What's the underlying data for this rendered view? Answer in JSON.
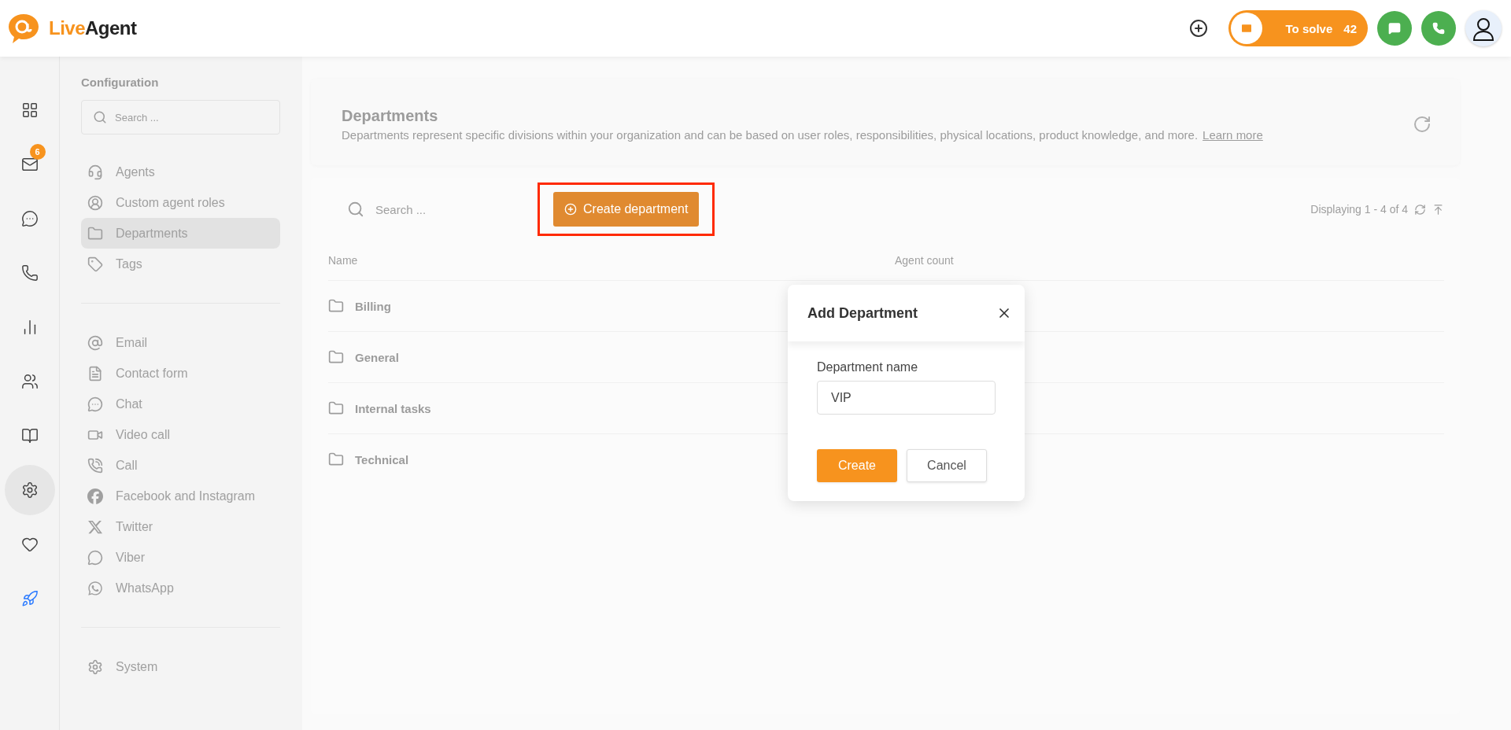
{
  "topbar": {
    "logo": {
      "part1": "Live",
      "part2": "Agent"
    },
    "to_solve": {
      "label": "To solve",
      "count": "42"
    }
  },
  "rail": [
    {
      "selected": false
    },
    {
      "selected": false,
      "badge": "6"
    },
    {
      "selected": false
    },
    {
      "selected": false
    },
    {
      "selected": false
    },
    {
      "selected": false
    },
    {
      "selected": false
    },
    {
      "selected": true
    },
    {
      "selected": false
    },
    {
      "selected": false
    }
  ],
  "config": {
    "title": "Configuration",
    "search": {
      "placeholder": "Search ..."
    },
    "groups": [
      {
        "items": [
          {
            "label": "Agents",
            "selected": false
          },
          {
            "label": "Custom agent roles",
            "selected": false
          },
          {
            "label": "Departments",
            "selected": true
          },
          {
            "label": "Tags",
            "selected": false
          }
        ]
      },
      {
        "items": [
          {
            "label": "Email",
            "selected": false
          },
          {
            "label": "Contact form",
            "selected": false
          },
          {
            "label": "Chat",
            "selected": false
          },
          {
            "label": "Video call",
            "selected": false
          },
          {
            "label": "Call",
            "selected": false
          },
          {
            "label": "Facebook and Instagram",
            "selected": false
          },
          {
            "label": "Twitter",
            "selected": false
          },
          {
            "label": "Viber",
            "selected": false
          },
          {
            "label": "WhatsApp",
            "selected": false
          }
        ]
      },
      {
        "items": [
          {
            "label": "System",
            "selected": false
          }
        ]
      }
    ]
  },
  "header": {
    "title": "Departments",
    "description": "Departments represent specific divisions within your organization and can be based on user roles, responsibilities, physical locations, product knowledge, and more.",
    "link": "Learn more"
  },
  "toolbar": {
    "search": {
      "placeholder": "Search ..."
    },
    "create_button": "Create department",
    "paging": "Displaying 1 - 4 of 4"
  },
  "table": {
    "columns": [
      "Name",
      "Agent count"
    ],
    "rows": [
      {
        "name": "Billing"
      },
      {
        "name": "General"
      },
      {
        "name": "Internal tasks"
      },
      {
        "name": "Technical"
      }
    ]
  },
  "dialog": {
    "title": "Add Department",
    "field_label": "Department name",
    "field_value": "VIP",
    "buttons": [
      {
        "label": "Create",
        "kind": "primary"
      },
      {
        "label": "Cancel",
        "kind": "secondary"
      }
    ]
  }
}
